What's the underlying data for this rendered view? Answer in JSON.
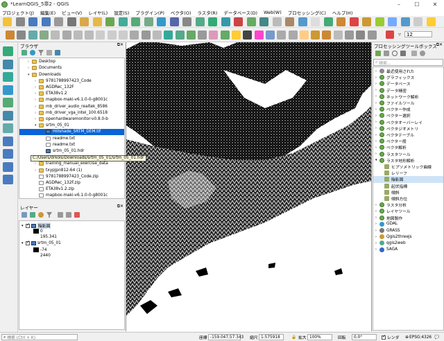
{
  "window": {
    "title": "*LearnQGIS_5章2 - QGIS",
    "buttons": [
      "–",
      "☐",
      "✕"
    ]
  },
  "menu": [
    "プロジェクト(J)",
    "編集(E)",
    "ビュー(V)",
    "レイヤ(L)",
    "設定(S)",
    "プラグイン(P)",
    "ベクタ(O)",
    "ラスタ(R)",
    "データベース(D)",
    "Web(W)",
    "プロセッシング(C)",
    "ヘルプ(H)"
  ],
  "toolbar": {
    "label_size": "12"
  },
  "browser": {
    "title": "ブラウザ",
    "items": [
      {
        "label": "Desktop",
        "type": "folder",
        "indent": 2
      },
      {
        "label": "Documents",
        "type": "folder",
        "indent": 2
      },
      {
        "label": "Downloads",
        "type": "folder",
        "indent": 2
      },
      {
        "label": "9781788997423_Code",
        "type": "folder",
        "indent": 3
      },
      {
        "label": "AGDRec_132F",
        "type": "folder",
        "indent": 3
      },
      {
        "label": "ETA38v1.2",
        "type": "folder",
        "indent": 3
      },
      {
        "label": "mapbox-maki-v6.1.0-0-g8001c",
        "type": "folder",
        "indent": 3
      },
      {
        "label": "mb_driver_audio_realtek_8586",
        "type": "folder",
        "indent": 3
      },
      {
        "label": "mb_driver_vga_intel_100.6518",
        "type": "folder",
        "indent": 3
      },
      {
        "label": "openhardwaremonitor-v0.8.0-b",
        "type": "folder",
        "indent": 3
      },
      {
        "label": "srtm_05_01",
        "type": "folder",
        "indent": 3
      },
      {
        "label": "Hillshade_SRTM_DEM.tif",
        "type": "raster",
        "indent": 4,
        "selected": true
      },
      {
        "label": "readme.txt",
        "type": "file",
        "indent": 4
      },
      {
        "label": "readme.txt",
        "type": "file",
        "indent": 4
      },
      {
        "label": "srtm_05_01.hdr",
        "type": "raster",
        "indent": 4
      },
      {
        "label": "",
        "type": "none",
        "indent": 4
      },
      {
        "label": "training_manual_exercise_data",
        "type": "folder",
        "indent": 3
      },
      {
        "label": "txypjpn812-64 (1)",
        "type": "folder",
        "indent": 3
      },
      {
        "label": "9781788997423_Code.zip",
        "type": "file",
        "indent": 3
      },
      {
        "label": "AGDRec_132F.zip",
        "type": "file",
        "indent": 3
      },
      {
        "label": "ETA38v1.2.zip",
        "type": "file",
        "indent": 3
      },
      {
        "label": "mapbox-maki-v6.1.0-0-g8001c",
        "type": "file",
        "indent": 3
      }
    ],
    "tooltip": "C:/Users/drkols/Downloads/srtm_05_01/srtm_05_01.hdr"
  },
  "layers": {
    "title": "レイヤー",
    "items": [
      {
        "name": "陰影図",
        "min": "0",
        "max": "195.341"
      },
      {
        "name": "srtm_05_01",
        "min": "-74",
        "max": "2440"
      }
    ]
  },
  "processing": {
    "title": "プロセッシングツールボックス",
    "search_placeholder": "検索...",
    "items": [
      {
        "label": "最近使用された",
        "indent": 1,
        "icon": "clock"
      },
      {
        "label": "グラフィックス",
        "indent": 1,
        "icon": "q"
      },
      {
        "label": "データベース",
        "indent": 1,
        "icon": "q"
      },
      {
        "label": "データ精密",
        "indent": 1,
        "icon": "q"
      },
      {
        "label": "ネットワーク解析",
        "indent": 1,
        "icon": "q"
      },
      {
        "label": "ファイルツール",
        "indent": 1,
        "icon": "q"
      },
      {
        "label": "ベクター作成",
        "indent": 1,
        "icon": "q"
      },
      {
        "label": "ベクター選択",
        "indent": 1,
        "icon": "q"
      },
      {
        "label": "ベクタオーバーレイ",
        "indent": 1,
        "icon": "q"
      },
      {
        "label": "ベクタジオメトリ",
        "indent": 1,
        "icon": "q"
      },
      {
        "label": "ベクタテーブル",
        "indent": 1,
        "icon": "q"
      },
      {
        "label": "ベクター般",
        "indent": 1,
        "icon": "q"
      },
      {
        "label": "ベクタ解析",
        "indent": 1,
        "icon": "q"
      },
      {
        "label": "ラスタツール",
        "indent": 1,
        "icon": "q"
      },
      {
        "label": "ラスタ地形解析",
        "indent": 1,
        "icon": "q",
        "open": true
      },
      {
        "label": "ヒプソメトリック曲線",
        "indent": 2,
        "icon": "tool"
      },
      {
        "label": "レリーフ",
        "indent": 2,
        "icon": "tool"
      },
      {
        "label": "陰影図",
        "indent": 2,
        "icon": "tool",
        "selected": true
      },
      {
        "label": "起伏指標",
        "indent": 2,
        "icon": "tool"
      },
      {
        "label": "傾斜",
        "indent": 2,
        "icon": "tool"
      },
      {
        "label": "傾斜方位",
        "indent": 2,
        "icon": "tool"
      },
      {
        "label": "ラスタ分析",
        "indent": 1,
        "icon": "q"
      },
      {
        "label": "レイヤツール",
        "indent": 1,
        "icon": "q"
      },
      {
        "label": "地図製作",
        "indent": 1,
        "icon": "q"
      },
      {
        "label": "GDAL",
        "indent": 1,
        "icon": "gdal"
      },
      {
        "label": "GRASS",
        "indent": 1,
        "icon": "gear"
      },
      {
        "label": "Qgis2threejs",
        "indent": 1,
        "icon": "tri"
      },
      {
        "label": "qgis2web",
        "indent": 1,
        "icon": "web"
      },
      {
        "label": "SAGA",
        "indent": 1,
        "icon": "saga"
      }
    ]
  },
  "status": {
    "search_placeholder": "検索 (Ctrl + K)",
    "coord_label": "座標",
    "coord_value": "-159.047,57.343",
    "scale_label": "縮尺",
    "scale_value": "1:575918",
    "magnify_label": "拡大",
    "magnify_value": "100%",
    "rotation_label": "回転",
    "rotation_value": "0.0°",
    "render_label": "レンダ",
    "crs": "EPSG:4326"
  }
}
